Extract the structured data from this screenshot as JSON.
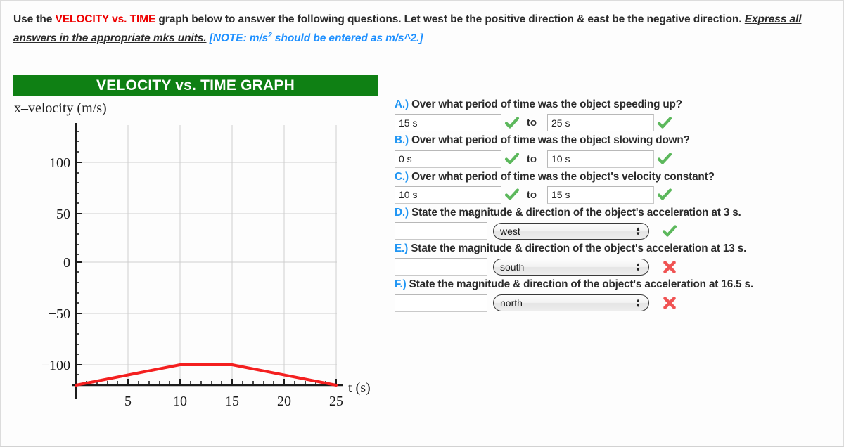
{
  "prompt": {
    "part1": "Use the ",
    "highlight": "VELOCITY vs. TIME",
    "part2": " graph below to answer the following questions. Let west be the positive direction & east be the negative direction. ",
    "emphasis": "Express all answers in the appropriate mks units.",
    "note_pre": " [NOTE: m/s",
    "note_sup": "2",
    "note_post": " should be entered as m/s^2.]",
    "highlight_color": "#ee0000",
    "note_color": "#1e90ff"
  },
  "graph": {
    "title": "VELOCITY vs. TIME GRAPH",
    "title_bg": "#0f8014",
    "y_axis_label": "x–velocity (m/s)",
    "x_axis_label": "t (s)"
  },
  "chart_data": {
    "type": "line",
    "title": "VELOCITY vs. TIME GRAPH",
    "xlabel": "t (s)",
    "ylabel": "x–velocity (m/s)",
    "xlim": [
      0,
      26
    ],
    "ylim": [
      -120,
      128
    ],
    "xticks": [
      5,
      10,
      15,
      20,
      25
    ],
    "xtick_labels": [
      "5",
      "10",
      "15",
      "20",
      "25"
    ],
    "yticks": [
      -100,
      -50,
      0,
      50,
      100
    ],
    "ytick_labels": [
      "−100",
      "−50",
      "0",
      "50",
      "100"
    ],
    "minor_tick_step_x": 1,
    "minor_tick_step_y": 10,
    "grid": true,
    "legend": false,
    "series": [
      {
        "name": "x-velocity",
        "color": "#f42020",
        "x": [
          0,
          10,
          15,
          25
        ],
        "y": [
          -120,
          -100,
          -100,
          -120
        ]
      }
    ]
  },
  "questions": [
    {
      "letter": "A.)",
      "text": "Over what period of time was the object speeding up?",
      "type": "range",
      "from_value": "15 s",
      "from_status": "correct",
      "to_label": "to",
      "to_value": "25 s",
      "to_status": "correct"
    },
    {
      "letter": "B.)",
      "text": "Over what period of time was the object slowing down?",
      "type": "range",
      "from_value": "0 s",
      "from_status": "correct",
      "to_label": "to",
      "to_value": "10 s",
      "to_status": "correct"
    },
    {
      "letter": "C.)",
      "text": "Over what period of time was the object's velocity constant?",
      "type": "range",
      "from_value": "10 s",
      "from_status": "correct",
      "to_label": "to",
      "to_value": "15 s",
      "to_status": "correct"
    },
    {
      "letter": "D.)",
      "text": "State the magnitude & direction of the object's acceleration at 3 s.",
      "type": "magnitude_direction",
      "magnitude_value": "",
      "direction_value": "west",
      "status": "correct"
    },
    {
      "letter": "E.)",
      "text": "State the magnitude & direction of the object's acceleration at 13 s.",
      "type": "magnitude_direction",
      "magnitude_value": "",
      "direction_value": "south",
      "status": "incorrect"
    },
    {
      "letter": "F.)",
      "text": "State the magnitude & direction of the object's acceleration at 16.5 s.",
      "type": "magnitude_direction",
      "magnitude_value": "",
      "direction_value": "north",
      "status": "incorrect"
    }
  ],
  "status_colors": {
    "correct": "#5cb85c",
    "incorrect": "#f05353"
  }
}
